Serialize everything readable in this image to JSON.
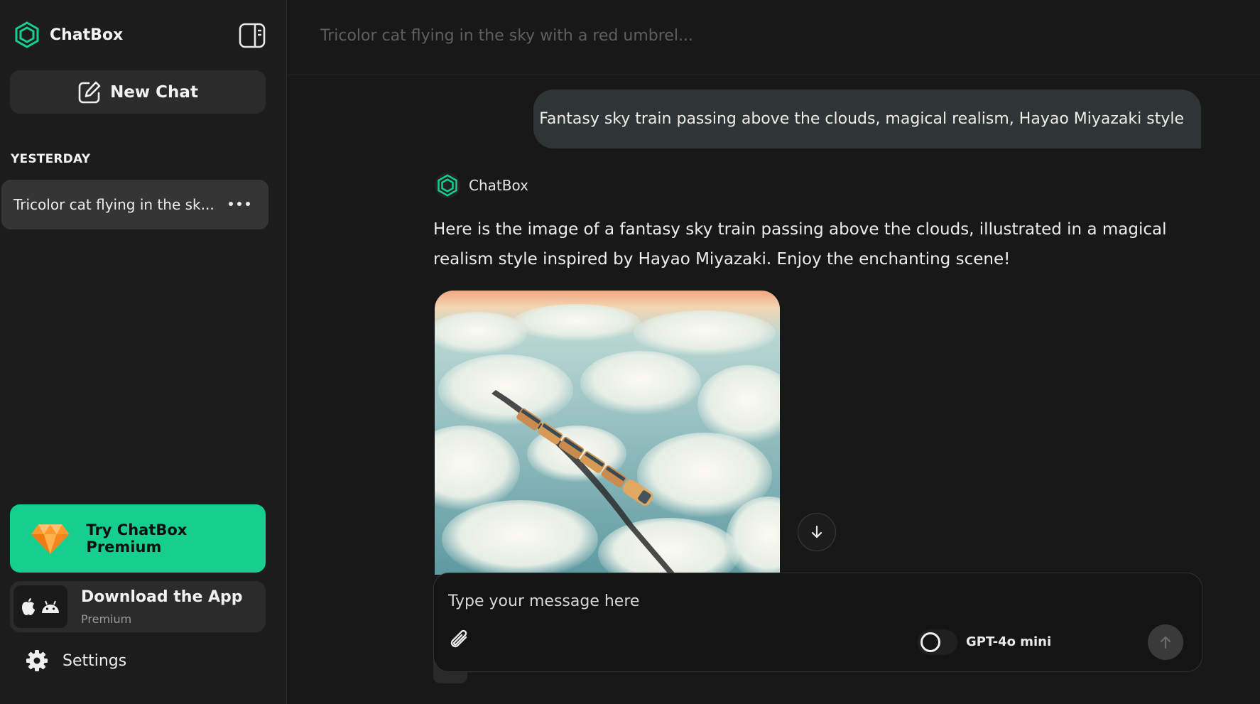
{
  "colors": {
    "accent": "#16cf8f",
    "background": "#181818",
    "sidebar": "#1c1c1c"
  },
  "sidebar": {
    "brand": {
      "name": "ChatBox",
      "icon": "chatbox-logo-icon"
    },
    "toggle_icon": "sidebar-toggle-icon",
    "new_chat": {
      "label": "New Chat",
      "icon": "edit-icon"
    },
    "section_label": "YESTERDAY",
    "chats": [
      {
        "title": "Tricolor cat flying in the sk...",
        "more_icon": "more-dots-icon"
      }
    ],
    "premium": {
      "label": "Try ChatBox Premium",
      "icon": "gem-icon"
    },
    "download": {
      "title": "Download the App",
      "subtitle": "Premium",
      "icons": [
        "apple-icon",
        "android-icon"
      ]
    },
    "settings": {
      "label": "Settings",
      "icon": "gear-icon"
    }
  },
  "main": {
    "topbar_title": "Tricolor cat flying in the sky with a red umbrel...",
    "messages": [
      {
        "role": "user",
        "text": "Fantasy sky train passing above the clouds, magical realism, Hayao Miyazaki style"
      },
      {
        "role": "assistant",
        "name": "ChatBox",
        "text": "Here is the image of a fantasy sky train passing above the clouds, illustrated in a magical realism style inspired by Hayao Miyazaki. Enjoy the enchanting scene!",
        "image": "generated-sky-train-image"
      }
    ],
    "scroll_down_icon": "arrow-down-icon",
    "composer": {
      "placeholder": "Type your message here",
      "value": "",
      "attach_icon": "paperclip-icon",
      "model": "GPT-4o mini",
      "send_icon": "arrow-up-icon"
    }
  }
}
